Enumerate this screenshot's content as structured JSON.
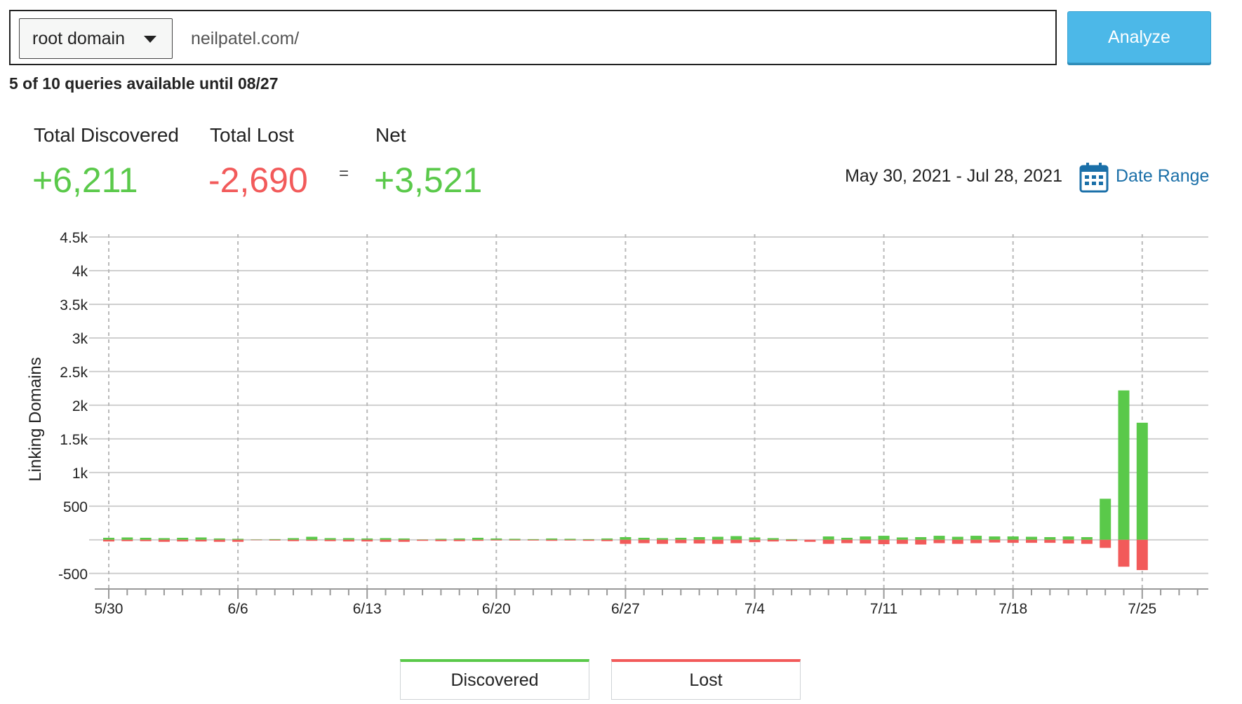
{
  "search": {
    "scope": "root domain",
    "url_value": "neilpatel.com/",
    "analyze_label": "Analyze",
    "quota_text": "5 of 10 queries available until 08/27"
  },
  "totals": {
    "discovered_label": "Total Discovered",
    "discovered_value": "+6,211",
    "lost_label": "Total Lost",
    "lost_value": "-2,690",
    "equals": "=",
    "net_label": "Net",
    "net_value": "+3,521"
  },
  "date_range": {
    "text": "May 30, 2021 - Jul 28, 2021",
    "link_label": "Date Range",
    "icon": "calendar-icon"
  },
  "colors": {
    "discovered": "#5ac94a",
    "lost": "#f25a5a",
    "link": "#1a6fa8",
    "button": "#4cb8e8"
  },
  "chart_data": {
    "type": "bar",
    "ylabel": "Linking Domains",
    "xlabel": "",
    "ylim": [
      -700,
      4500
    ],
    "y_ticks": [
      {
        "value": 4500,
        "label": "4.5k"
      },
      {
        "value": 4000,
        "label": "4k"
      },
      {
        "value": 3500,
        "label": "3.5k"
      },
      {
        "value": 3000,
        "label": "3k"
      },
      {
        "value": 2500,
        "label": "2.5k"
      },
      {
        "value": 2000,
        "label": "2k"
      },
      {
        "value": 1500,
        "label": "1.5k"
      },
      {
        "value": 1000,
        "label": "1k"
      },
      {
        "value": 500,
        "label": "500"
      },
      {
        "value": -500,
        "label": "-500"
      }
    ],
    "x_ticks": [
      "5/30",
      "6/6",
      "6/13",
      "6/20",
      "6/27",
      "7/4",
      "7/11",
      "7/18",
      "7/25"
    ],
    "categories": [
      "5/30",
      "5/31",
      "6/1",
      "6/2",
      "6/3",
      "6/4",
      "6/5",
      "6/6",
      "6/7",
      "6/8",
      "6/9",
      "6/10",
      "6/11",
      "6/12",
      "6/13",
      "6/14",
      "6/15",
      "6/16",
      "6/17",
      "6/18",
      "6/19",
      "6/20",
      "6/21",
      "6/22",
      "6/23",
      "6/24",
      "6/25",
      "6/26",
      "6/27",
      "6/28",
      "6/29",
      "6/30",
      "7/1",
      "7/2",
      "7/3",
      "7/4",
      "7/5",
      "7/6",
      "7/7",
      "7/8",
      "7/9",
      "7/10",
      "7/11",
      "7/12",
      "7/13",
      "7/14",
      "7/15",
      "7/16",
      "7/17",
      "7/18",
      "7/19",
      "7/20",
      "7/21",
      "7/22",
      "7/23",
      "7/24"
    ],
    "series": [
      {
        "name": "Discovered",
        "values": [
          30,
          35,
          30,
          25,
          30,
          35,
          20,
          15,
          5,
          10,
          25,
          45,
          25,
          25,
          20,
          25,
          20,
          5,
          15,
          20,
          30,
          20,
          15,
          10,
          20,
          15,
          10,
          20,
          40,
          30,
          25,
          30,
          40,
          45,
          55,
          35,
          25,
          10,
          0,
          50,
          30,
          50,
          60,
          35,
          40,
          60,
          45,
          60,
          50,
          50,
          45,
          40,
          50,
          40,
          610,
          2220,
          1740
        ]
      },
      {
        "name": "Lost",
        "values": [
          -25,
          -20,
          -20,
          -30,
          -25,
          -25,
          -30,
          -30,
          -5,
          -10,
          -20,
          -15,
          -20,
          -25,
          -25,
          -30,
          -30,
          -15,
          -20,
          -20,
          -15,
          -10,
          -10,
          -10,
          -15,
          -10,
          -15,
          -20,
          -60,
          -50,
          -60,
          -50,
          -55,
          -60,
          -50,
          -35,
          -25,
          -20,
          -30,
          -60,
          -50,
          -55,
          -65,
          -60,
          -70,
          -50,
          -60,
          -50,
          -40,
          -45,
          -45,
          -45,
          -55,
          -60,
          -120,
          -400,
          -450
        ]
      }
    ],
    "grid": true,
    "legend": [
      "Discovered",
      "Lost"
    ],
    "legend_position": "bottom-center"
  },
  "legend": {
    "discovered_label": "Discovered",
    "lost_label": "Lost"
  }
}
